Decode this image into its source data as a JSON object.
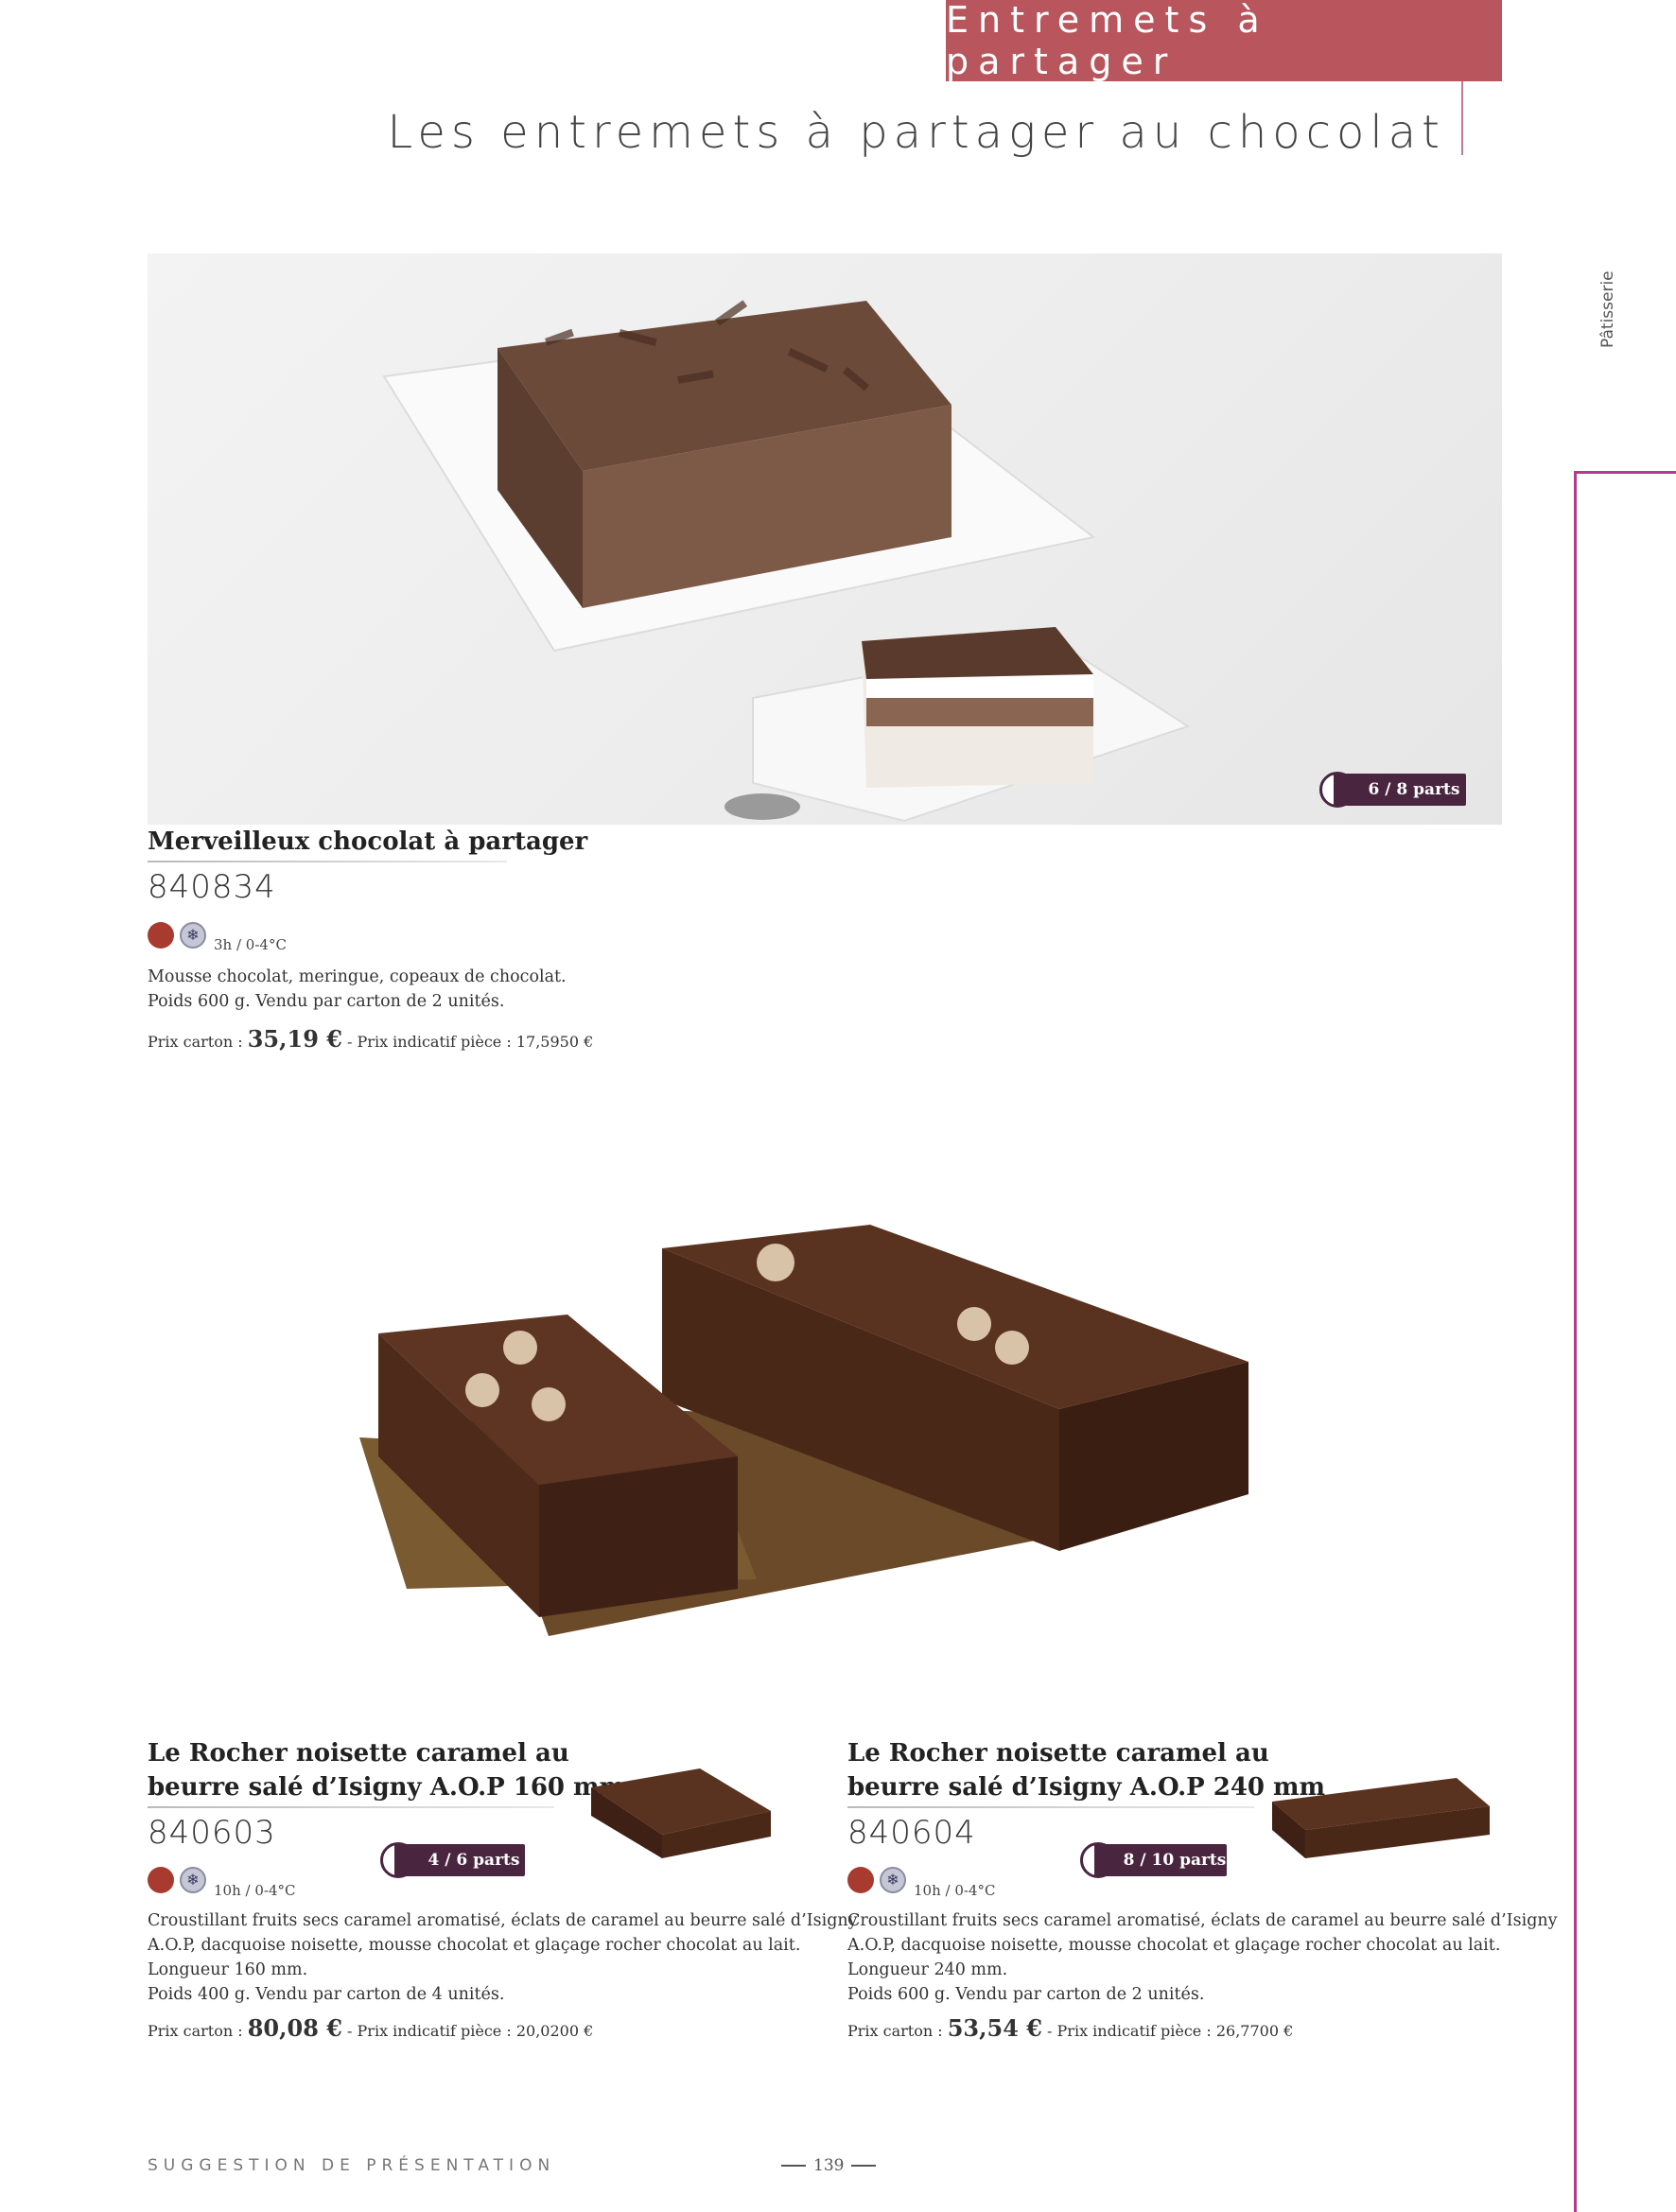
{
  "header": {
    "category": "Entremets à partager",
    "title": "Les entremets à partager au chocolat"
  },
  "side_tab": {
    "label": "Pâtisserie"
  },
  "products": [
    {
      "name": "Merveilleux chocolat à partager",
      "code": "840834",
      "parts": "6 / 8 parts",
      "storage": "3h / 0-4°C",
      "description": [
        "Mousse chocolat, meringue, copeaux de chocolat.",
        "Poids 600 g. Vendu par carton de 2 unités."
      ],
      "price_label": "Prix carton :",
      "price": "35,19 €",
      "unit_price": "- Prix indicatif pièce : 17,5950 €"
    },
    {
      "name_lines": [
        "Le Rocher noisette caramel au",
        "beurre salé d’Isigny A.O.P 160 mm"
      ],
      "code": "840603",
      "parts": "4 / 6 parts",
      "storage": "10h / 0-4°C",
      "description": [
        "Croustillant fruits secs caramel aromatisé, éclats de caramel au beurre salé d’Isigny",
        "A.O.P, dacquoise noisette, mousse chocolat et glaçage rocher chocolat au lait.",
        "Longueur 160 mm.",
        "Poids 400 g. Vendu par carton de 4 unités."
      ],
      "price_label": "Prix carton :",
      "price": "80,08 €",
      "unit_price": "- Prix indicatif pièce : 20,0200 €"
    },
    {
      "name_lines": [
        "Le Rocher noisette caramel au",
        "beurre salé d’Isigny A.O.P 240 mm"
      ],
      "code": "840604",
      "parts": "8 / 10 parts",
      "storage": "10h / 0-4°C",
      "description": [
        "Croustillant fruits secs caramel aromatisé, éclats de caramel au beurre salé d’Isigny",
        "A.O.P, dacquoise noisette, mousse chocolat et glaçage rocher chocolat au lait.",
        "Longueur 240 mm.",
        "Poids 600 g. Vendu par carton de 2 unités."
      ],
      "price_label": "Prix carton :",
      "price": "53,54 €",
      "unit_price": "- Prix indicatif pièce : 26,7700 €"
    }
  ],
  "footer": {
    "suggestion": "SUGGESTION DE PRÉSENTATION",
    "page_number": "139"
  },
  "colors": {
    "accent": "#b8555d",
    "side_tab": "#b03c8a",
    "badge": "#4a2540",
    "red_dot": "#a83a30"
  },
  "icons": [
    "pie-portion-icon",
    "fresh-dot-icon",
    "snowflake-icon"
  ]
}
